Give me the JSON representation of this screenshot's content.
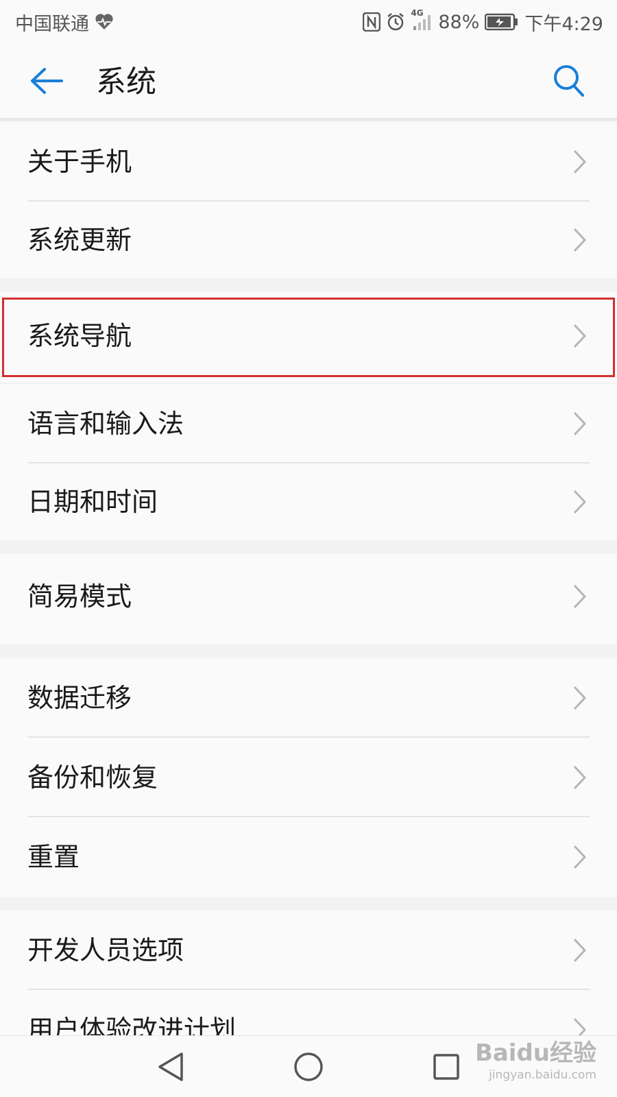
{
  "status_bar": {
    "carrier": "中国联通",
    "network": "4G",
    "battery": "88%",
    "time": "下午4:29",
    "icons": [
      "heart-monitor-icon",
      "nfc-icon",
      "alarm-icon",
      "signal-icon",
      "battery-charging-icon"
    ]
  },
  "header": {
    "title": "系统",
    "back_icon": "back-arrow-icon",
    "search_icon": "search-icon"
  },
  "settings": {
    "groups": [
      {
        "items": [
          {
            "label": "关于手机"
          },
          {
            "label": "系统更新"
          }
        ]
      },
      {
        "items": [
          {
            "label": "系统导航",
            "highlighted": true
          }
        ]
      },
      {
        "items": [
          {
            "label": "语言和输入法"
          },
          {
            "label": "日期和时间"
          }
        ]
      },
      {
        "items": [
          {
            "label": "简易模式"
          }
        ]
      },
      {
        "items": [
          {
            "label": "数据迁移"
          },
          {
            "label": "备份和恢复"
          },
          {
            "label": "重置"
          }
        ]
      },
      {
        "items": [
          {
            "label": "开发人员选项"
          },
          {
            "label": "用户体验改进计划"
          }
        ]
      }
    ]
  },
  "nav_bar": {
    "icons": [
      "back-triangle-icon",
      "home-circle-icon",
      "recents-square-icon"
    ]
  },
  "colors": {
    "accent": "#1a7fd8",
    "highlight_border": "#d32f2f",
    "chevron": "#b5b5b5",
    "background": "#f2f2f2"
  },
  "watermark": {
    "logo": "Baidu经验",
    "url": "jingyan.baidu.com"
  }
}
